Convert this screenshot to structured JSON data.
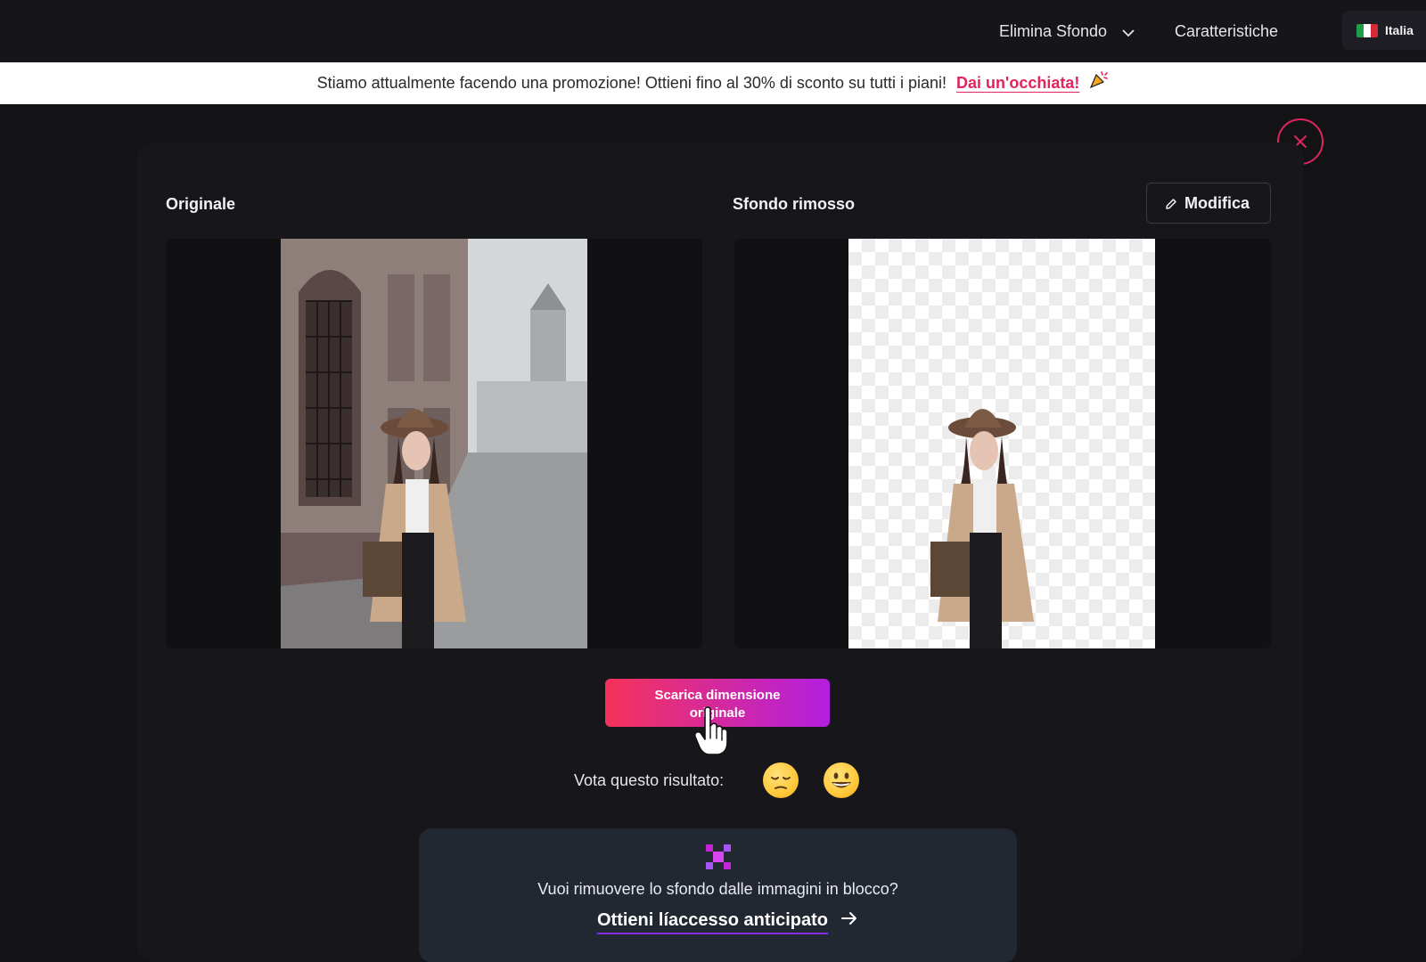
{
  "nav": {
    "remove_bg": "Elimina Sfondo",
    "features": "Caratteristiche",
    "language": "Italia"
  },
  "promo": {
    "text": "Stiamo attualmente facendo una promozione! Ottieni fino al 30% di sconto su tutti i piani!",
    "link": "Dai un'occhiata!"
  },
  "result": {
    "original_label": "Originale",
    "removed_label": "Sfondo rimosso",
    "edit_label": "Modifica",
    "download_label": "Scarica dimensione originale"
  },
  "rating": {
    "label": "Vota questo risultato:"
  },
  "bulk": {
    "question": "Vuoi rimuovere lo sfondo dalle immagini in blocco?",
    "cta": "Ottieni líaccesso anticipato"
  },
  "colors": {
    "accent": "#e0245e",
    "gradient_start": "#f5335a",
    "gradient_end": "#b31fe0",
    "background": "#131316"
  }
}
